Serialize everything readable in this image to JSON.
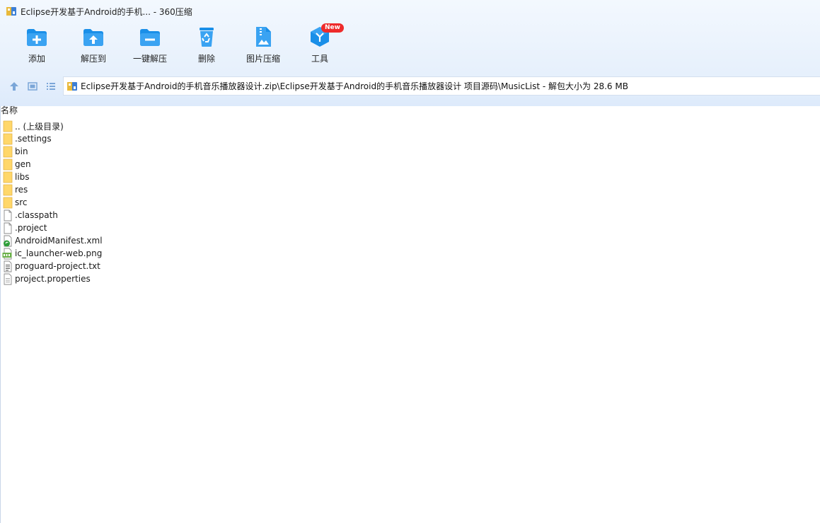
{
  "window": {
    "title": "Eclipse开发基于Android的手机... - 360压缩"
  },
  "toolbar": {
    "add": "添加",
    "extract_to": "解压到",
    "one_click_extract": "一键解压",
    "delete": "删除",
    "image_compress": "图片压缩",
    "tools": "工具",
    "new_badge": "New"
  },
  "address": {
    "path": "Eclipse开发基于Android的手机音乐播放器设计.zip\\Eclipse开发基于Android的手机音乐播放器设计 项目源码\\MusicList - 解包大小为 28.6 MB"
  },
  "list": {
    "column_name": "名称",
    "items": [
      {
        "name": ".. (上级目录)",
        "type": "folder"
      },
      {
        "name": ".settings",
        "type": "folder"
      },
      {
        "name": "bin",
        "type": "folder"
      },
      {
        "name": "gen",
        "type": "folder"
      },
      {
        "name": "libs",
        "type": "folder"
      },
      {
        "name": "res",
        "type": "folder"
      },
      {
        "name": "src",
        "type": "folder"
      },
      {
        "name": ".classpath",
        "type": "file"
      },
      {
        "name": ".project",
        "type": "file"
      },
      {
        "name": "AndroidManifest.xml",
        "type": "xml"
      },
      {
        "name": "ic_launcher-web.png",
        "type": "png"
      },
      {
        "name": "proguard-project.txt",
        "type": "txt"
      },
      {
        "name": "project.properties",
        "type": "properties"
      }
    ]
  },
  "colors": {
    "toolbar_icon_blue": "#1a8fe8",
    "folder_yellow": "#ffd76a",
    "badge_red": "#ee2b2b"
  }
}
